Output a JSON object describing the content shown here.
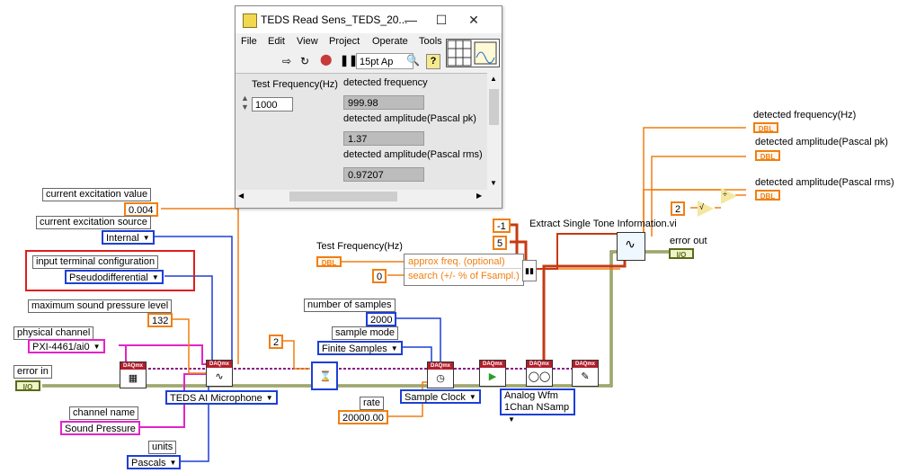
{
  "front_panel": {
    "title": "TEDS Read Sens_TEDS_20...",
    "menu": [
      "File",
      "Edit",
      "View",
      "Project",
      "Operate",
      "Tools"
    ],
    "font_selector": "15pt Ap",
    "controls": {
      "test_frequency_label": "Test Frequency(Hz)",
      "test_frequency_value": "1000"
    },
    "indicators": [
      {
        "label": "detected frequency",
        "value": "999.98"
      },
      {
        "label": "detected amplitude(Pascal pk)",
        "value": "1.37"
      },
      {
        "label": "detected amplitude(Pascal rms)",
        "value": "0.97207"
      }
    ]
  },
  "block_diagram": {
    "current_excitation_value": {
      "label": "current excitation value",
      "value": "0.004"
    },
    "current_excitation_source": {
      "label": "current excitation source",
      "value": "Internal"
    },
    "input_terminal_configuration": {
      "label": "input terminal configuration",
      "value": "Pseudodifferential"
    },
    "max_sound_pressure": {
      "label": "maximum sound pressure level",
      "value": "132"
    },
    "physical_channel": {
      "label": "physical channel",
      "value": "PXI-4461/ai0"
    },
    "error_in": {
      "label": "error in"
    },
    "channel_name": {
      "label": "channel name",
      "value": "Sound Pressure"
    },
    "units": {
      "label": "units",
      "value": "Pascals"
    },
    "teds_polymorphic": "TEDS AI Microphone",
    "wait_constant": "2",
    "number_of_samples": {
      "label": "number of samples",
      "value": "2000"
    },
    "sample_mode": {
      "label": "sample mode",
      "value": "Finite Samples"
    },
    "rate": {
      "label": "rate",
      "value": "20000.00"
    },
    "timing_polymorphic": "Sample Clock",
    "read_polymorphic_line1": "Analog Wfm",
    "read_polymorphic_line2": "1Chan NSamp",
    "test_frequency_terminal": {
      "label": "Test Frequency(Hz)"
    },
    "approx_freq_label": "approx freq. (optional)",
    "search_label": "search (+/- % of Fsampl.)",
    "search_value": "0",
    "neg_one": "-1",
    "five": "5",
    "extract_vi_label": "Extract Single Tone Information.vi",
    "error_out": {
      "label": "error out"
    },
    "divisor_constant": "2",
    "outputs": [
      {
        "label": "detected frequency(Hz)"
      },
      {
        "label": "detected amplitude(Pascal pk)"
      },
      {
        "label": "detected amplitude(Pascal rms)"
      }
    ],
    "daqmx_header": "DAQmx",
    "dbl_tag": "DBL",
    "err_tag": "I/O"
  },
  "colors": {
    "numeric_wire": "#f07f12",
    "enum_wire": "#1d3fd6",
    "string_wire": "#e224c6",
    "error_wire": "#5b6a1a",
    "task_wire": "#8a1a8a",
    "dynamic_wire": "#c63a12",
    "highlight_box": "#e01d1d"
  }
}
